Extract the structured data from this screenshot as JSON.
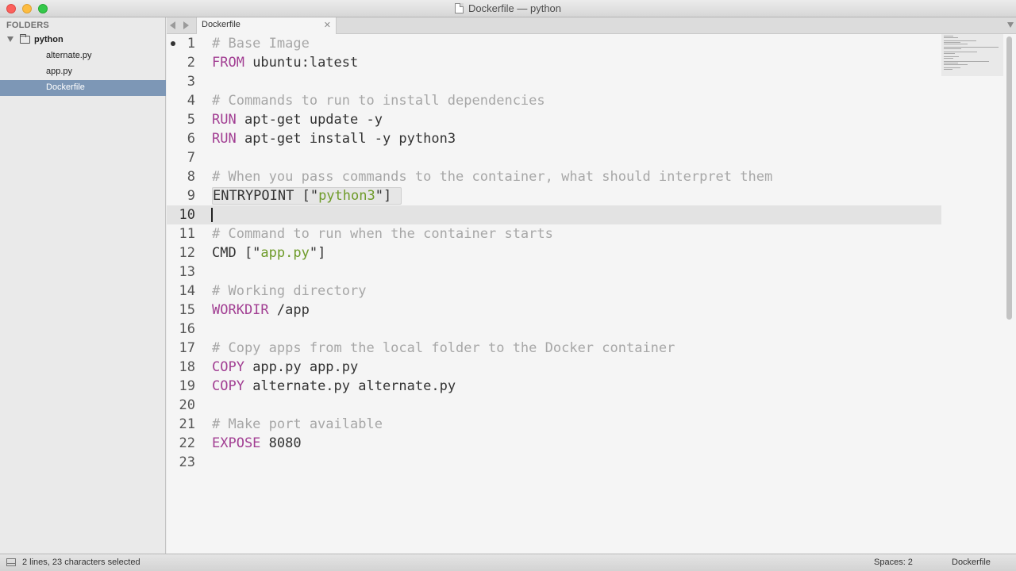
{
  "window": {
    "title": "Dockerfile — python"
  },
  "sidebar": {
    "header": "FOLDERS",
    "folder": "python",
    "files": [
      "alternate.py",
      "app.py",
      "Dockerfile"
    ],
    "selected_file": "Dockerfile"
  },
  "tabs": {
    "active": {
      "label": "Dockerfile",
      "close": "✕"
    }
  },
  "editor": {
    "current_line": 10,
    "lines": [
      {
        "n": "1",
        "tokens": [
          {
            "t": "# Base Image",
            "c": "comment"
          }
        ]
      },
      {
        "n": "2",
        "tokens": [
          {
            "t": "FROM",
            "c": "kw"
          },
          {
            "t": " ubuntu:latest",
            "c": "plain"
          }
        ]
      },
      {
        "n": "3",
        "tokens": []
      },
      {
        "n": "4",
        "tokens": [
          {
            "t": "# Commands to run to install dependencies",
            "c": "comment"
          }
        ]
      },
      {
        "n": "5",
        "tokens": [
          {
            "t": "RUN",
            "c": "kw"
          },
          {
            "t": " apt-get update -y",
            "c": "plain"
          }
        ]
      },
      {
        "n": "6",
        "tokens": [
          {
            "t": "RUN",
            "c": "kw"
          },
          {
            "t": " apt-get install -y python3",
            "c": "plain"
          }
        ]
      },
      {
        "n": "7",
        "tokens": []
      },
      {
        "n": "8",
        "tokens": [
          {
            "t": "# When you pass commands to the container, what should interpret them",
            "c": "comment"
          }
        ]
      },
      {
        "n": "9",
        "selected": true,
        "tokens": [
          {
            "t": "ENTRYPOINT [\"",
            "c": "plain"
          },
          {
            "t": "python3",
            "c": "str"
          },
          {
            "t": "\"]",
            "c": "plain"
          }
        ]
      },
      {
        "n": "10",
        "tokens": []
      },
      {
        "n": "11",
        "tokens": [
          {
            "t": "# Command to run when the container starts",
            "c": "comment"
          }
        ]
      },
      {
        "n": "12",
        "tokens": [
          {
            "t": "CMD [\"",
            "c": "plain"
          },
          {
            "t": "app.py",
            "c": "str"
          },
          {
            "t": "\"]",
            "c": "plain"
          }
        ]
      },
      {
        "n": "13",
        "tokens": []
      },
      {
        "n": "14",
        "tokens": [
          {
            "t": "# Working directory",
            "c": "comment"
          }
        ]
      },
      {
        "n": "15",
        "tokens": [
          {
            "t": "WORKDIR",
            "c": "kw"
          },
          {
            "t": " /app",
            "c": "plain"
          }
        ]
      },
      {
        "n": "16",
        "tokens": []
      },
      {
        "n": "17",
        "tokens": [
          {
            "t": "# Copy apps from the local folder to the Docker container",
            "c": "comment"
          }
        ]
      },
      {
        "n": "18",
        "tokens": [
          {
            "t": "COPY",
            "c": "kw"
          },
          {
            "t": " app.py app.py",
            "c": "plain"
          }
        ]
      },
      {
        "n": "19",
        "tokens": [
          {
            "t": "COPY",
            "c": "kw"
          },
          {
            "t": " alternate.py alternate.py",
            "c": "plain"
          }
        ]
      },
      {
        "n": "20",
        "tokens": []
      },
      {
        "n": "21",
        "tokens": [
          {
            "t": "# Make port available",
            "c": "comment"
          }
        ]
      },
      {
        "n": "22",
        "tokens": [
          {
            "t": "EXPOSE",
            "c": "kw"
          },
          {
            "t": " 8080",
            "c": "plain"
          }
        ]
      },
      {
        "n": "23",
        "tokens": []
      }
    ]
  },
  "statusbar": {
    "selection": "2 lines, 23 characters selected",
    "indent": "Spaces: 2",
    "syntax": "Dockerfile"
  },
  "colors": {
    "keyword": "#a23f93",
    "string": "#6e9b29",
    "comment": "#a7a7a7",
    "selected_sidebar": "#7d97b6"
  }
}
